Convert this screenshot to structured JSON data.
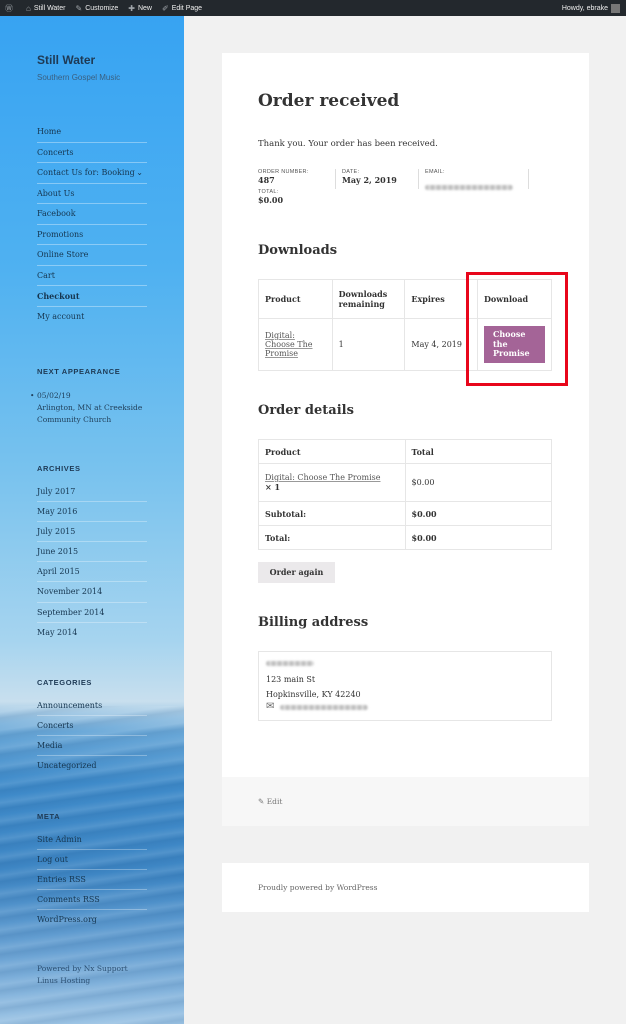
{
  "adminbar": {
    "site": "Still Water",
    "customize": "Customize",
    "new": "New",
    "edit_page": "Edit Page",
    "howdy": "Howdy, ebrake"
  },
  "sidebar": {
    "site_title": "Still Water",
    "site_description": "Southern Gospel Music",
    "menu": [
      {
        "label": "Home"
      },
      {
        "label": "Concerts"
      },
      {
        "label": "Contact Us for: Booking"
      },
      {
        "label": "About Us"
      },
      {
        "label": "Facebook"
      },
      {
        "label": "Promotions"
      },
      {
        "label": "Online Store"
      },
      {
        "label": "Cart"
      },
      {
        "label": "Checkout"
      },
      {
        "label": "My account"
      }
    ],
    "next_appearance": {
      "title": "NEXT APPEARANCE",
      "date": "05/02/19",
      "location_line1": "Arlington, MN at Creekside",
      "location_line2": "Community Church"
    },
    "archives": {
      "title": "ARCHIVES",
      "items": [
        "July 2017",
        "May 2016",
        "July 2015",
        "June 2015",
        "April 2015",
        "November 2014",
        "September 2014",
        "May 2014"
      ]
    },
    "categories": {
      "title": "CATEGORIES",
      "items": [
        "Announcements",
        "Concerts",
        "Media",
        "Uncategorized"
      ]
    },
    "meta": {
      "title": "META",
      "items": [
        "Site Admin",
        "Log out",
        "Entries RSS",
        "Comments RSS",
        "WordPress.org"
      ]
    },
    "powered_line1": "Powered by Nx Support",
    "powered_line2": "Linus Hosting"
  },
  "order": {
    "title": "Order received",
    "thank_you": "Thank you. Your order has been received.",
    "order_number_label": "ORDER NUMBER:",
    "order_number": "487",
    "date_label": "DATE:",
    "date": "May 2, 2019",
    "email_label": "EMAIL:",
    "total_label": "TOTAL:",
    "total": "$0.00"
  },
  "downloads": {
    "title": "Downloads",
    "headers": {
      "product": "Product",
      "remaining_line1": "Downloads",
      "remaining_line2": "remaining",
      "expires": "Expires",
      "download": "Download"
    },
    "row": {
      "product_line1": "Digital:",
      "product_line2": "Choose The",
      "product_line3": "Promise",
      "remaining": "1",
      "expires": "May 4, 2019",
      "button_line1": "Choose",
      "button_line2": "the",
      "button_line3": "Promise"
    }
  },
  "order_details": {
    "title": "Order details",
    "headers": {
      "product": "Product",
      "total": "Total"
    },
    "item": {
      "name": "Digital: Choose The Promise",
      "qty": "× 1",
      "total": "$0.00"
    },
    "subtotal_label": "Subtotal:",
    "subtotal": "$0.00",
    "total_label": "Total:",
    "total": "$0.00",
    "order_again": "Order again"
  },
  "billing": {
    "title": "Billing address",
    "street": "123 main St",
    "city": "Hopkinsville, KY 42240"
  },
  "edit_label": "Edit",
  "footer": {
    "text": "Proudly powered by WordPress"
  },
  "colors": {
    "button_purple": "#a46497",
    "highlight_red": "#e8061b",
    "adminbar": "#23282d"
  }
}
